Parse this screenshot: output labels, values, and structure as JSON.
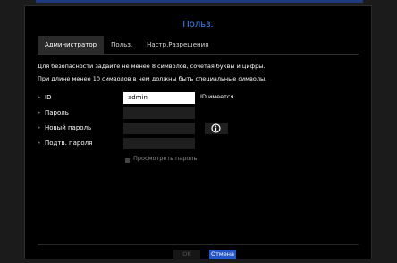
{
  "dialog": {
    "title": "Польз."
  },
  "tabs": [
    {
      "label": "Администратор",
      "active": true
    },
    {
      "label": "Польз.",
      "active": false
    },
    {
      "label": "Настр.Разрешения",
      "active": false
    }
  ],
  "info": {
    "line1": "Для безопасности задайте не менее 8 символов, сочетая буквы и цифры.",
    "line2": "При длине менее 10 символов в нем должны быть специальные символы."
  },
  "form": {
    "id": {
      "label": "ID",
      "value": "admin",
      "note": "ID имеется."
    },
    "password": {
      "label": "Пароль",
      "value": ""
    },
    "new_password": {
      "label": "Новый пароль",
      "value": "",
      "icon": "info-icon"
    },
    "confirm_password": {
      "label": "Подтв. пароля",
      "value": ""
    },
    "show_password": {
      "label": "Просмотреть пароль",
      "checked": false
    }
  },
  "buttons": {
    "ok": "OK",
    "cancel": "Отмена"
  },
  "colors": {
    "accent": "#3f84f1",
    "primary_button": "#2456c9",
    "background": "#000000"
  }
}
